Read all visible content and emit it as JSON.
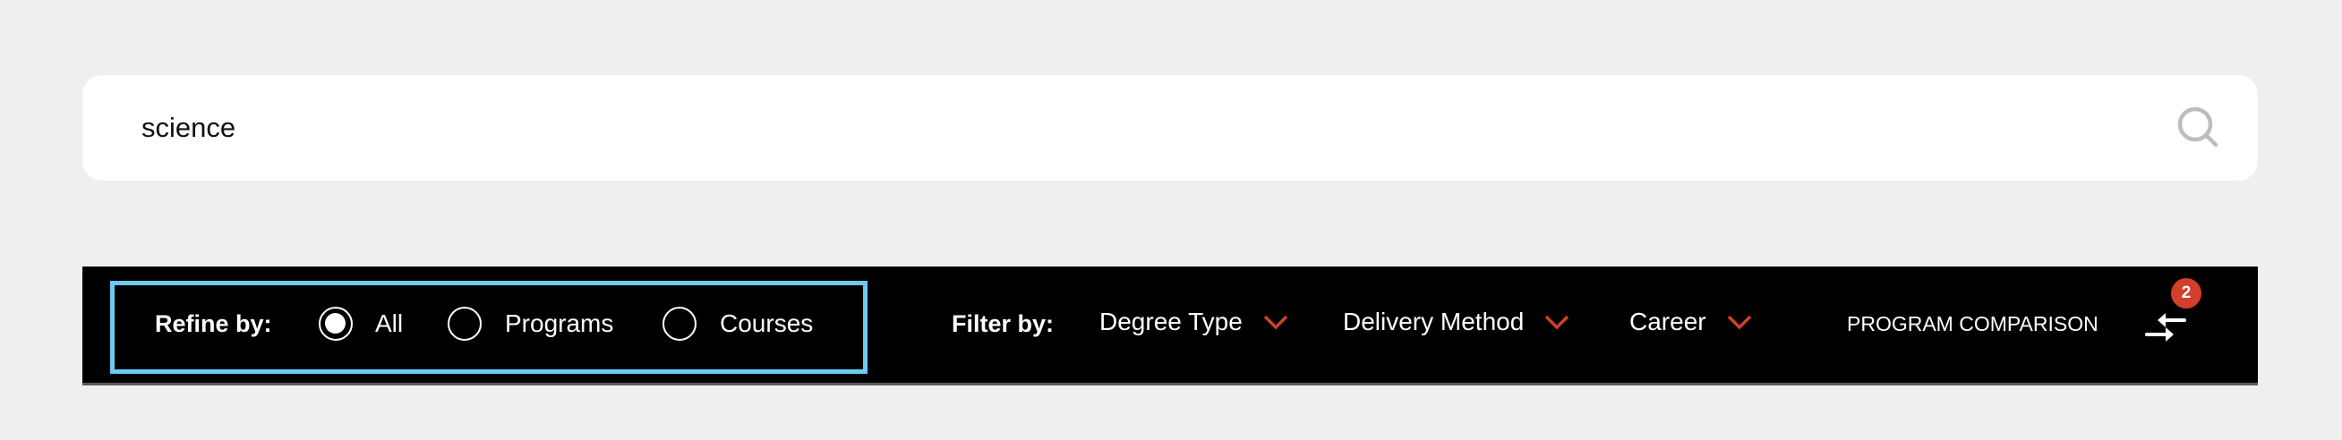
{
  "search": {
    "value": "science",
    "icon": "search-icon"
  },
  "refine": {
    "label": "Refine by:",
    "options": [
      {
        "label": "All",
        "checked": true
      },
      {
        "label": "Programs",
        "checked": false
      },
      {
        "label": "Courses",
        "checked": false
      }
    ]
  },
  "filter": {
    "label": "Filter by:",
    "dropdowns": [
      {
        "label": "Degree Type"
      },
      {
        "label": "Delivery Method"
      },
      {
        "label": "Career"
      }
    ]
  },
  "comparison": {
    "label": "PROGRAM COMPARISON",
    "count": "2",
    "icon": "compare-arrows-icon"
  },
  "colors": {
    "accent": "#d23f2b",
    "focus": "#6bcbf1",
    "bar": "#000000",
    "background": "#efefef"
  }
}
